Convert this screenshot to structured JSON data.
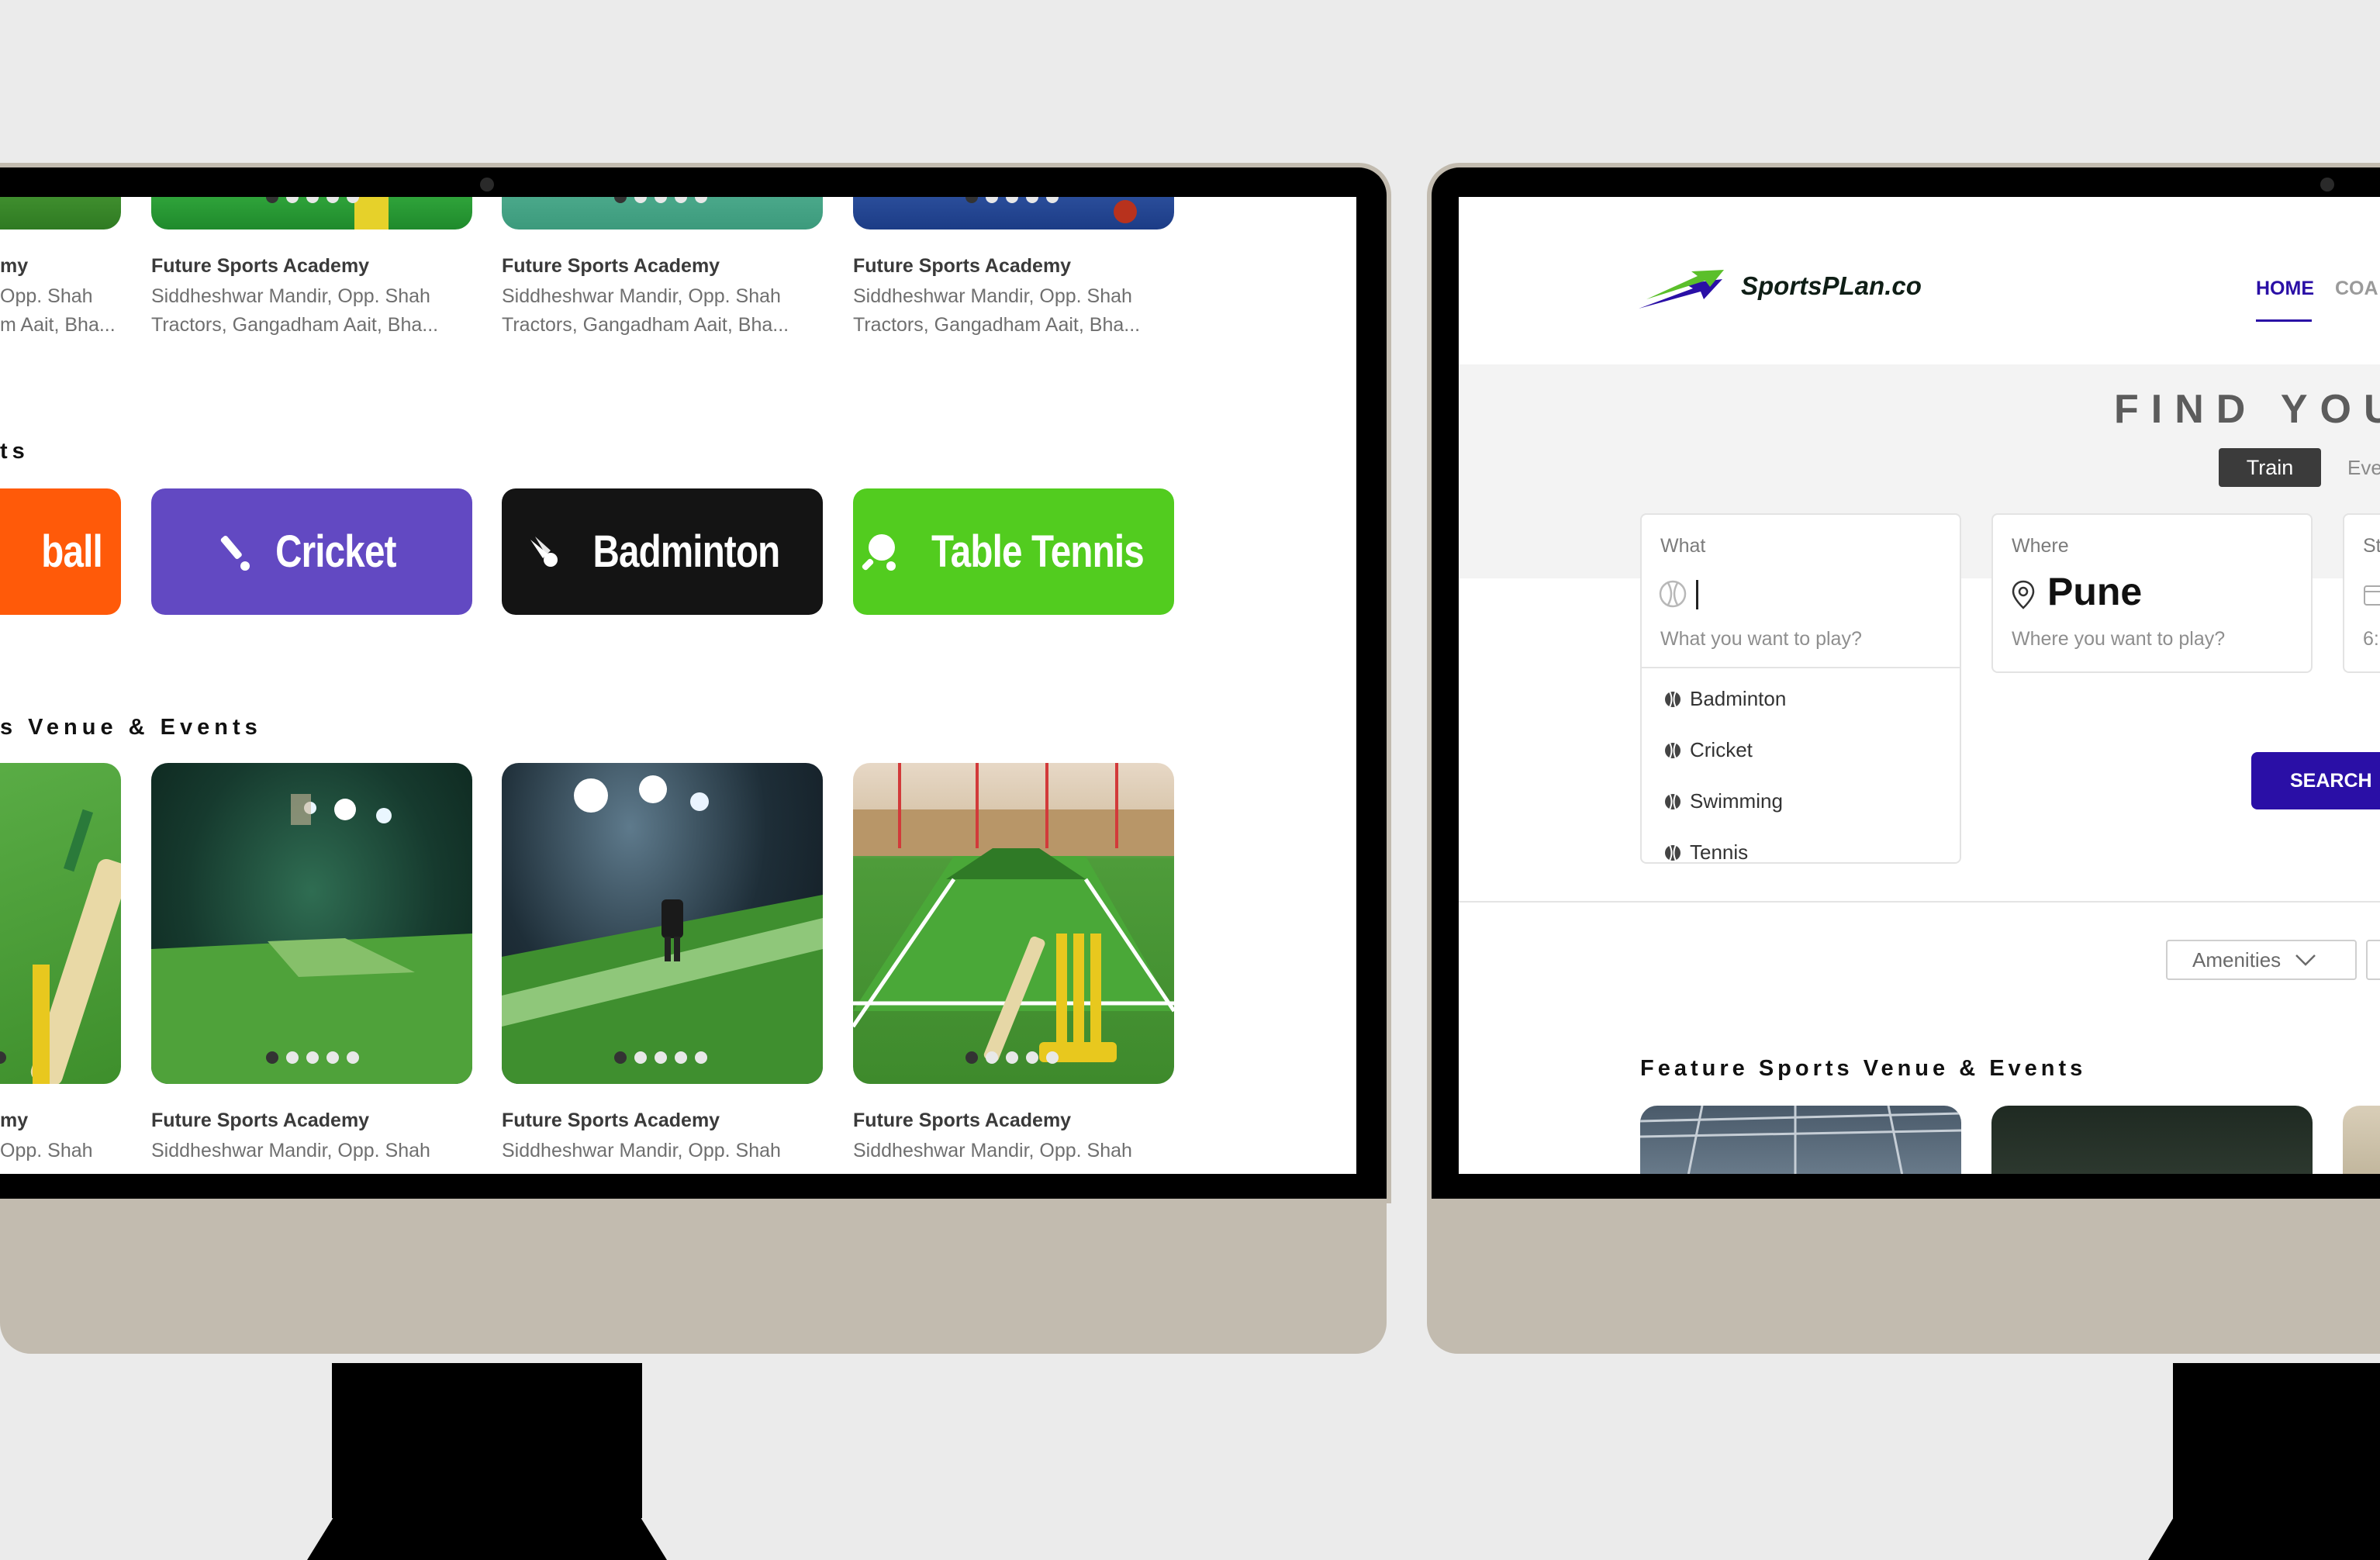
{
  "left": {
    "top_cards": [
      {
        "title": "my",
        "addr1": "Opp. Shah",
        "addr2": "m Aait, Bha..."
      },
      {
        "title": "Future Sports Academy",
        "addr1": "Siddheshwar Mandir, Opp. Shah",
        "addr2": "Tractors, Gangadham Aait, Bha..."
      },
      {
        "title": "Future Sports Academy",
        "addr1": "Siddheshwar Mandir, Opp. Shah",
        "addr2": "Tractors, Gangadham Aait, Bha..."
      },
      {
        "title": "Future Sports Academy",
        "addr1": "Siddheshwar Mandir, Opp. Shah",
        "addr2": "Tractors, Gangadham Aait, Bha..."
      }
    ],
    "sports_section_title": "ts",
    "sports": [
      {
        "label": "ball",
        "color": "#ff5a09"
      },
      {
        "label": "Cricket",
        "color": "#6249c2",
        "icon": "cricket-bat-icon"
      },
      {
        "label": "Badminton",
        "color": "#141414",
        "icon": "shuttlecock-icon"
      },
      {
        "label": "Table Tennis",
        "color": "#52cc1f",
        "icon": "table-tennis-icon"
      }
    ],
    "venue_section_title": "s Venue & Events",
    "bottom_cards": [
      {
        "title": "my",
        "addr1": "Opp. Shah"
      },
      {
        "title": "Future Sports Academy",
        "addr1": "Siddheshwar Mandir, Opp. Shah"
      },
      {
        "title": "Future Sports Academy",
        "addr1": "Siddheshwar Mandir, Opp. Shah"
      },
      {
        "title": "Future Sports Academy",
        "addr1": "Siddheshwar Mandir, Opp. Shah"
      }
    ]
  },
  "right": {
    "brand": "SportsPLan.co",
    "nav": {
      "home": "HOME",
      "next": "COA"
    },
    "hero_title": "FIND YOUR",
    "tabs": {
      "train": "Train",
      "events": "Eve"
    },
    "what": {
      "label": "What",
      "help": "What you want to play?"
    },
    "where": {
      "label": "Where",
      "value": "Pune",
      "help": "Where you want to play?"
    },
    "third": {
      "label": "St",
      "help": "6:"
    },
    "dropdown": [
      "Badminton",
      "Cricket",
      "Swimming",
      "Tennis"
    ],
    "search_label": "SEARCH",
    "amenities_label": "Amenities",
    "feature_title": "Feature Sports Venue & Events"
  },
  "colors": {
    "brand_blue": "#2a0fa6",
    "brand_green": "#5bbf2a"
  }
}
